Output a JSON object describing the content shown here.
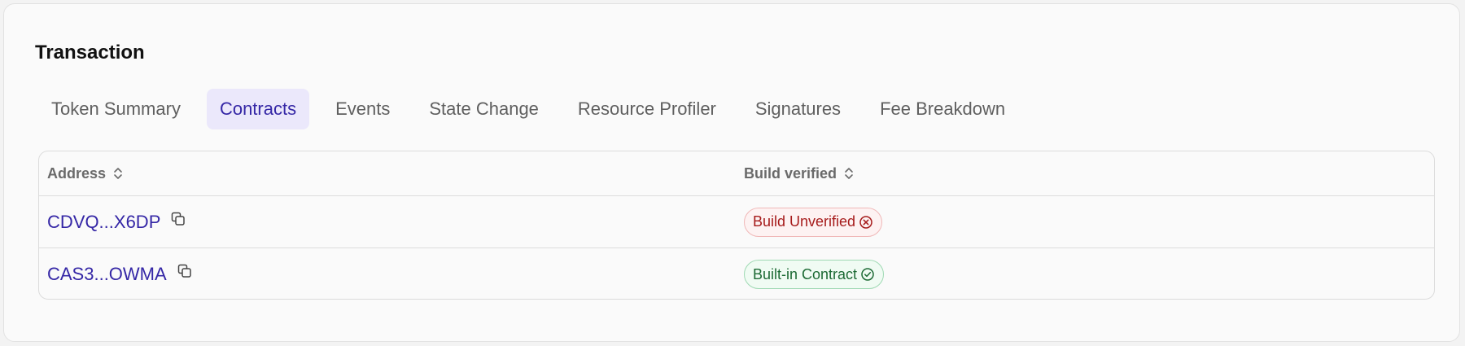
{
  "card": {
    "title": "Transaction"
  },
  "tabs": [
    {
      "label": "Token Summary",
      "active": false
    },
    {
      "label": "Contracts",
      "active": true
    },
    {
      "label": "Events",
      "active": false
    },
    {
      "label": "State Change",
      "active": false
    },
    {
      "label": "Resource Profiler",
      "active": false
    },
    {
      "label": "Signatures",
      "active": false
    },
    {
      "label": "Fee Breakdown",
      "active": false
    }
  ],
  "table": {
    "headers": {
      "address": "Address",
      "build_verified": "Build verified"
    },
    "rows": [
      {
        "address": "CDVQ...X6DP",
        "status": "Build Unverified",
        "status_kind": "unverified",
        "status_icon": "x-circle-icon"
      },
      {
        "address": "CAS3...OWMA",
        "status": "Built-in Contract",
        "status_kind": "verified",
        "status_icon": "check-circle-icon"
      }
    ]
  },
  "colors": {
    "accent": "#3527a6",
    "active_tab_bg": "#ebe8fb",
    "unverified_text": "#a61b1b",
    "unverified_bg": "#fdf2f2",
    "verified_text": "#1c6a34",
    "verified_bg": "#f0fbf3"
  }
}
